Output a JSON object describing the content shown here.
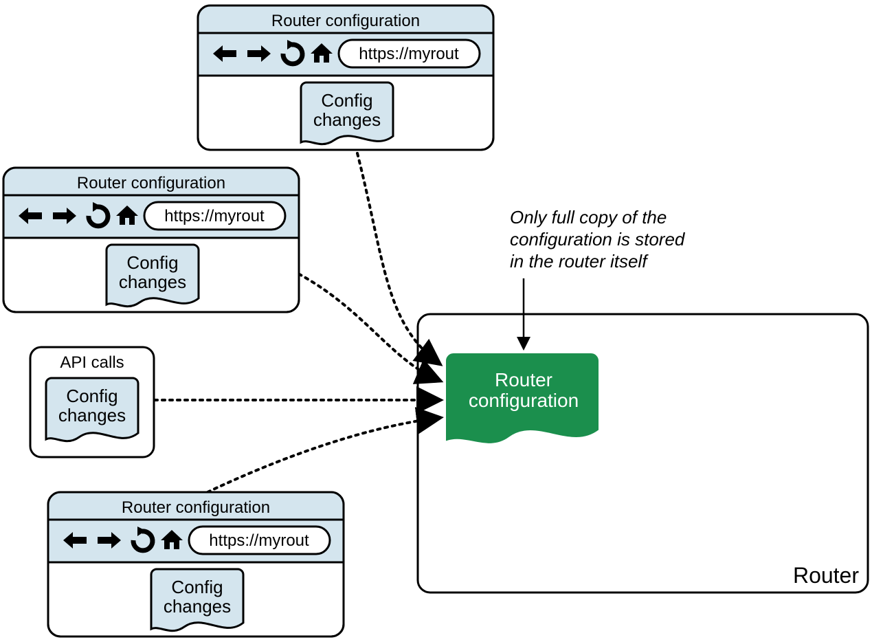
{
  "browser": {
    "title": "Router configuration",
    "url": "https://myrout",
    "doc_line1": "Config",
    "doc_line2": "changes"
  },
  "api_box": {
    "title": "API calls",
    "doc_line1": "Config",
    "doc_line2": "changes"
  },
  "router": {
    "label": "Router",
    "config_line1": "Router",
    "config_line2": "configuration"
  },
  "annotation": {
    "line1": "Only full copy of the",
    "line2": "configuration is stored",
    "line3": "in the router itself"
  },
  "icons": {
    "back": "back-arrow-icon",
    "forward": "forward-arrow-icon",
    "reload": "reload-icon",
    "home": "home-icon"
  },
  "colors": {
    "titlebar_fill": "#d4e5ee",
    "doc_fill": "#d4e5ee",
    "router_doc_fill": "#1b8f4d",
    "stroke": "#000000"
  }
}
